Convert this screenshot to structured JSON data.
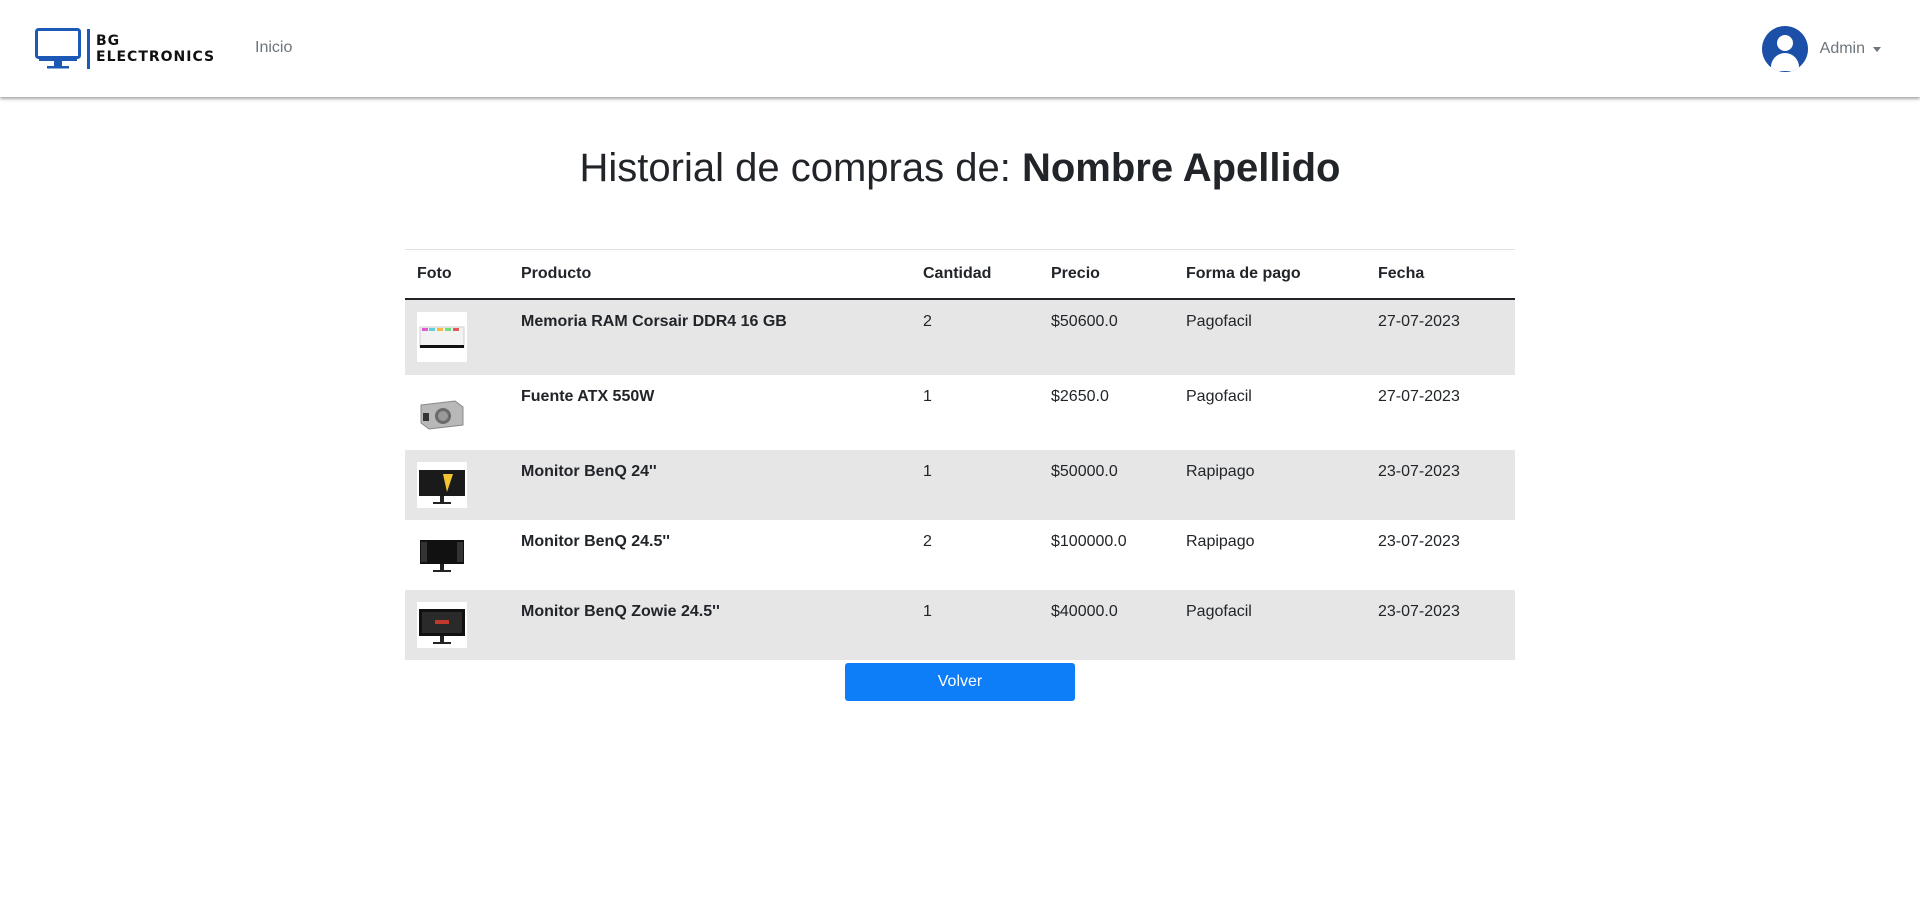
{
  "navbar": {
    "brand_line1": "BG",
    "brand_line2": "ELECTRONICS",
    "nav_inicio": "Inicio",
    "user_name": "Admin"
  },
  "page": {
    "title_prefix": "Historial de compras de:",
    "title_name": "Nombre Apellido"
  },
  "table": {
    "headers": [
      "Foto",
      "Producto",
      "Cantidad",
      "Precio",
      "Forma de pago",
      "Fecha"
    ],
    "rows": [
      {
        "image_icon": "ram-memory-icon",
        "product": "Memoria RAM Corsair DDR4 16 GB",
        "quantity": "2",
        "price": "$50600.0",
        "payment": "Pagofacil",
        "date": "27-07-2023"
      },
      {
        "image_icon": "power-supply-icon",
        "product": "Fuente ATX 550W",
        "quantity": "1",
        "price": "$2650.0",
        "payment": "Pagofacil",
        "date": "27-07-2023"
      },
      {
        "image_icon": "monitor-icon",
        "product": "Monitor BenQ 24''",
        "quantity": "1",
        "price": "$50000.0",
        "payment": "Rapipago",
        "date": "23-07-2023"
      },
      {
        "image_icon": "monitor-icon",
        "product": "Monitor BenQ 24.5''",
        "quantity": "2",
        "price": "$100000.0",
        "payment": "Rapipago",
        "date": "23-07-2023"
      },
      {
        "image_icon": "monitor-icon",
        "product": "Monitor BenQ Zowie 24.5''",
        "quantity": "1",
        "price": "$40000.0",
        "payment": "Pagofacil",
        "date": "23-07-2023"
      }
    ]
  },
  "actions": {
    "back_label": "Volver"
  },
  "colors": {
    "brand_blue": "#1c58b5",
    "button_blue": "#0d7ef7",
    "striped_row": "#e6e6e6"
  }
}
